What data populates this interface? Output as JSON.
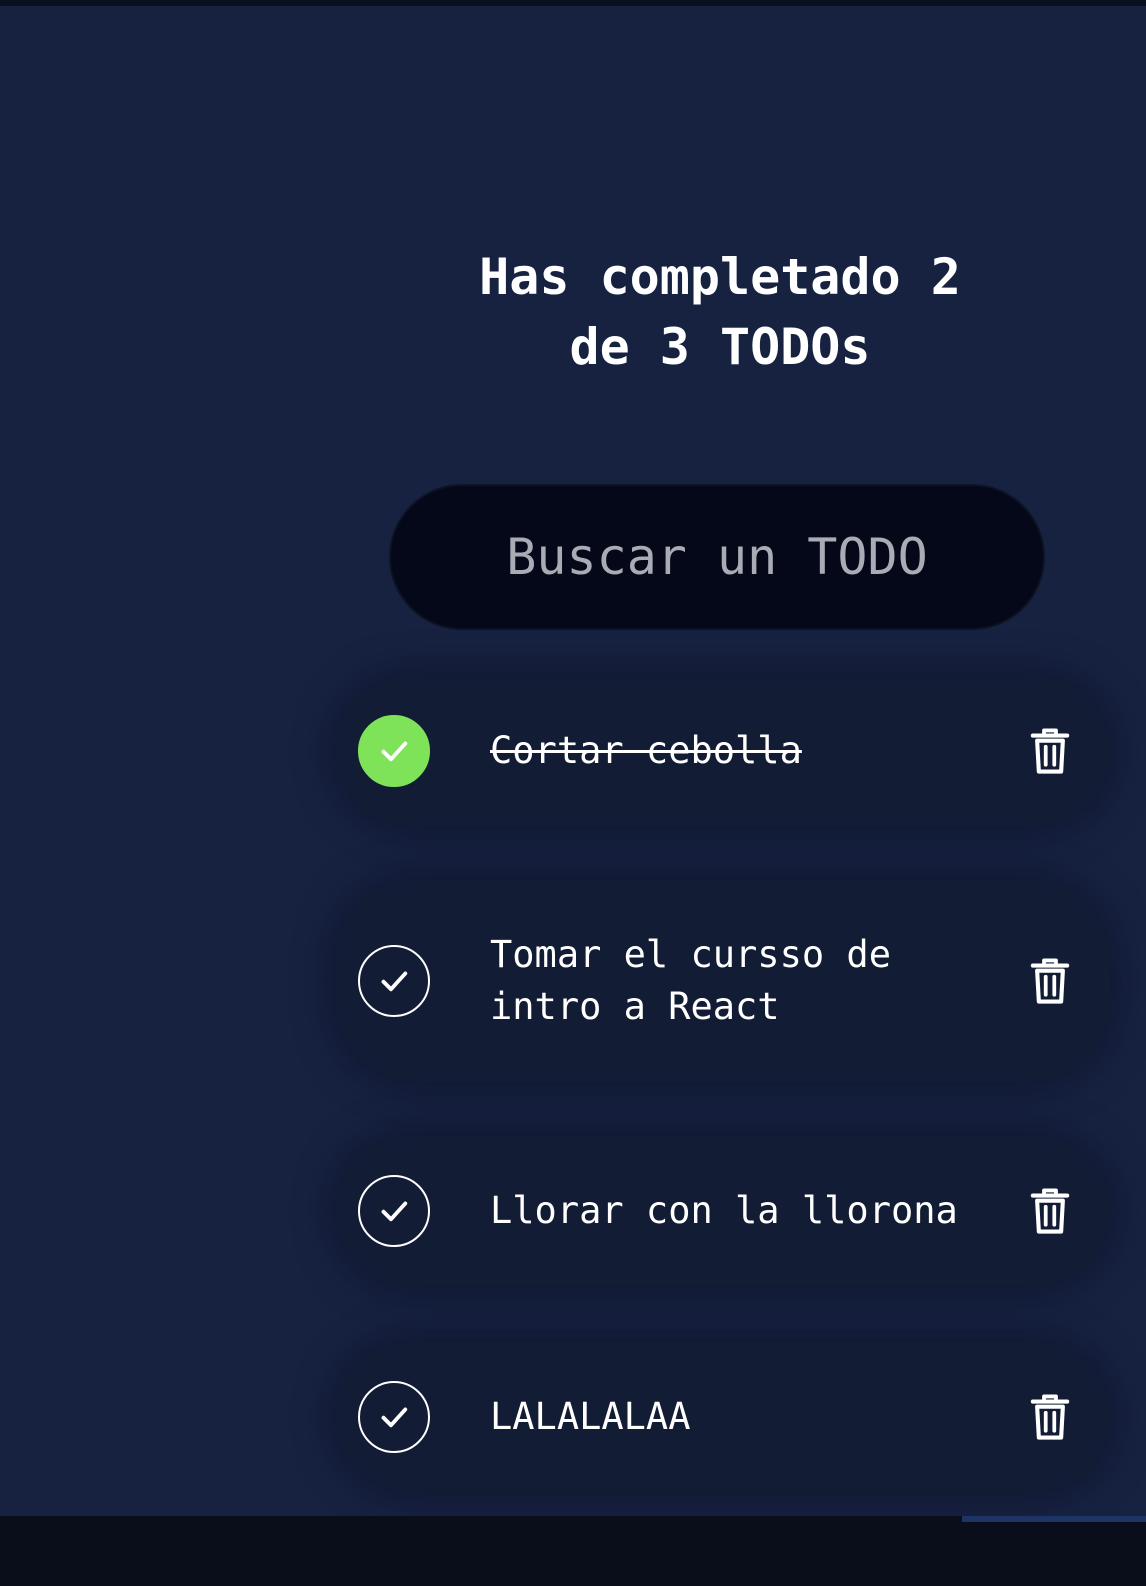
{
  "counter": {
    "line1": "Has completado 2",
    "line2": "de 3 TODOs"
  },
  "search": {
    "placeholder": "Buscar un TODO",
    "value": ""
  },
  "todos": [
    {
      "text": "Cortar cebolla",
      "completed": true
    },
    {
      "text_line1": "Tomar el cursso de",
      "text_line2": "intro a React",
      "completed": false
    },
    {
      "text": "Llorar con la llorona",
      "completed": false
    },
    {
      "text": "LALALALAA",
      "completed": false
    }
  ],
  "icons": {
    "complete": "check-icon",
    "delete": "trash-icon"
  },
  "colors": {
    "background": "#172241",
    "item_background": "#131c35",
    "search_background": "#040818",
    "completed_check": "#7fe35a",
    "text": "#ffffff",
    "placeholder": "#a9acb4"
  }
}
